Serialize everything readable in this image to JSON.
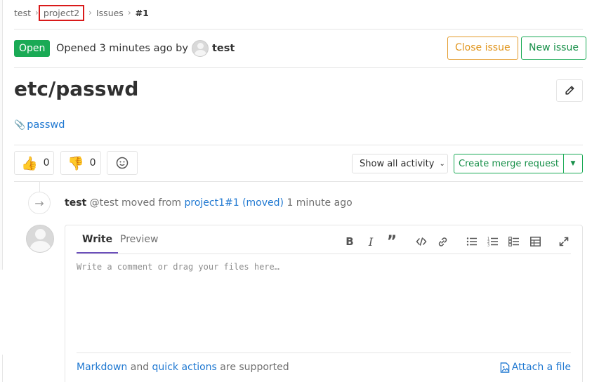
{
  "breadcrumb": {
    "items": [
      "test",
      "project2",
      "Issues",
      "#1"
    ]
  },
  "issue": {
    "status": "Open",
    "opened_text": "Opened 3 minutes ago by",
    "author": "test",
    "title": "etc/passwd",
    "description_link": "passwd"
  },
  "header_buttons": {
    "close": "Close issue",
    "new": "New issue"
  },
  "awards": {
    "thumbs_up_count": "0",
    "thumbs_down_count": "0"
  },
  "activity_filter": {
    "label": "Show all activity"
  },
  "merge_request": {
    "label": "Create merge request"
  },
  "event": {
    "author": "test",
    "handle_action": "@test moved from",
    "link": "project1#1 (moved)",
    "time": "1 minute ago"
  },
  "comment": {
    "tab_write": "Write",
    "tab_preview": "Preview",
    "placeholder": "Write a comment or drag your files here…",
    "footer_markdown": "Markdown",
    "footer_and": "and",
    "footer_quick_actions": "quick actions",
    "footer_supported": "are supported",
    "attach": "Attach a file"
  },
  "colors": {
    "open_green": "#1aaa55",
    "close_orange": "#e0941a",
    "link_blue": "#1f78d1",
    "highlight_red": "#d91a1a"
  }
}
